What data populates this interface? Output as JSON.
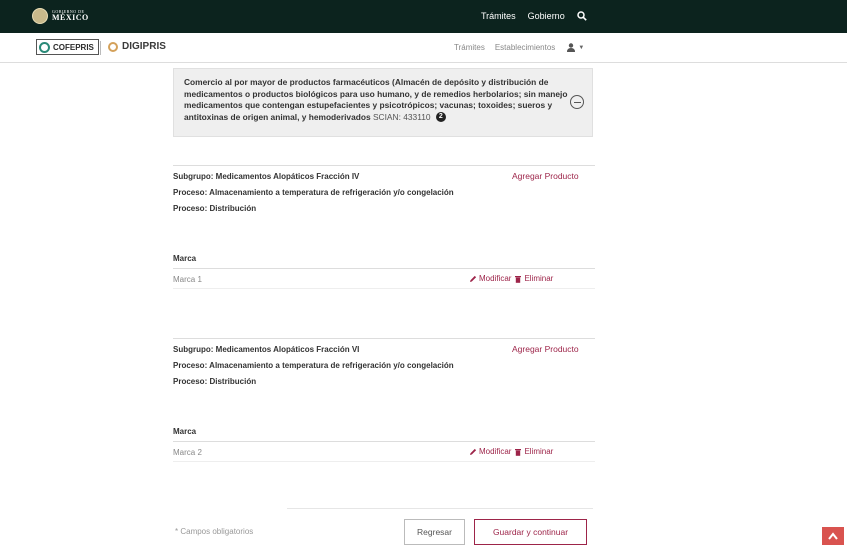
{
  "gov_bar": {
    "logo_small": "GOBIERNO DE",
    "logo_big": "MÉXICO",
    "nav": [
      "Trámites",
      "Gobierno"
    ],
    "search_icon": "search-icon"
  },
  "header": {
    "cofepris_label": "COFEPRIS",
    "digipris_label": "DIGIPRIS",
    "nav": [
      "Trámites",
      "Establecimientos"
    ],
    "user_icon": "user-icon"
  },
  "info": {
    "text": "Comercio al por mayor de productos farmacéuticos (Almacén de depósito y distribución de medicamentos o productos biológicos para uso humano, y de remedios herbolarios; sin manejo medicamentos que contengan estupefacientes y psicotrópicos; vacunas; toxoides; sueros y antitoxinas de origen animal, y hemoderivados",
    "scian": "SCIAN: 433110",
    "badge": "2"
  },
  "subgroups": [
    {
      "title": "Subgrupo: Medicamentos Alopáticos Fracción IV",
      "proceso1": "Proceso: Almacenamiento a temperatura de refrigeración y/o congelación",
      "proceso2": "Proceso: Distribución",
      "add_label": "Agregar Producto",
      "marca_header": "Marca",
      "marca": "Marca 1",
      "modify_label": "Modificar",
      "delete_label": "Eliminar"
    },
    {
      "title": "Subgrupo: Medicamentos Alopáticos Fracción VI",
      "proceso1": "Proceso: Almacenamiento a temperatura de refrigeración y/o congelación",
      "proceso2": "Proceso: Distribución",
      "add_label": "Agregar Producto",
      "marca_header": "Marca",
      "marca": "Marca 2",
      "modify_label": "Modificar",
      "delete_label": "Eliminar"
    }
  ],
  "footer": {
    "required_note": "* Campos obligatorios",
    "back_label": "Regresar",
    "save_label": "Guardar y continuar"
  },
  "colors": {
    "gov_bar": "#0c231e",
    "accent": "#9d2449",
    "scroll_top": "#d9534f"
  }
}
